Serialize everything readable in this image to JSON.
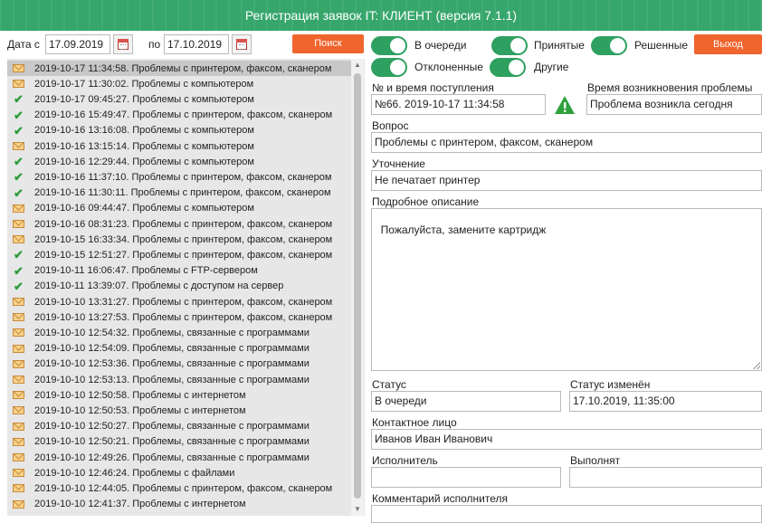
{
  "window": {
    "title": "Регистрация заявок IT: КЛИЕНТ (версия 7.1.1)"
  },
  "filter": {
    "date_from_label": "Дата с",
    "date_from": "17.09.2019",
    "date_to_label": "по",
    "date_to": "17.10.2019",
    "search_label": "Поиск"
  },
  "toggles": {
    "queued": "В очереди",
    "accepted": "Принятые",
    "solved": "Решенные",
    "rejected": "Отклоненные",
    "other": "Другие"
  },
  "exit_label": "Выход",
  "requests": [
    {
      "icon": "envelope-icon",
      "text": "2019-10-17 11:34:58. Проблемы с принтером, факсом, сканером",
      "selected": true
    },
    {
      "icon": "envelope-icon",
      "text": "2019-10-17 11:30:02. Проблемы с компьютером"
    },
    {
      "icon": "check-icon",
      "text": "2019-10-17 09:45:27. Проблемы с компьютером"
    },
    {
      "icon": "check-icon",
      "text": "2019-10-16 15:49:47. Проблемы с принтером, факсом, сканером"
    },
    {
      "icon": "check-icon",
      "text": "2019-10-16 13:16:08. Проблемы с компьютером"
    },
    {
      "icon": "envelope-icon",
      "text": "2019-10-16 13:15:14. Проблемы с компьютером"
    },
    {
      "icon": "check-icon",
      "text": "2019-10-16 12:29:44. Проблемы с компьютером"
    },
    {
      "icon": "check-icon",
      "text": "2019-10-16 11:37:10. Проблемы с принтером, факсом, сканером"
    },
    {
      "icon": "check-icon",
      "text": "2019-10-16 11:30:11. Проблемы с принтером, факсом, сканером"
    },
    {
      "icon": "envelope-icon",
      "text": "2019-10-16 09:44:47. Проблемы с компьютером"
    },
    {
      "icon": "envelope-icon",
      "text": "2019-10-16 08:31:23. Проблемы с принтером, факсом, сканером"
    },
    {
      "icon": "envelope-icon",
      "text": "2019-10-15 16:33:34. Проблемы с принтером, факсом, сканером"
    },
    {
      "icon": "check-icon",
      "text": "2019-10-15 12:51:27. Проблемы с принтером, факсом, сканером"
    },
    {
      "icon": "check-icon",
      "text": "2019-10-11 16:06:47. Проблемы с FTP-сервером"
    },
    {
      "icon": "check-icon",
      "text": "2019-10-11 13:39:07. Проблемы с доступом на сервер"
    },
    {
      "icon": "envelope-icon",
      "text": "2019-10-10 13:31:27. Проблемы с принтером, факсом, сканером"
    },
    {
      "icon": "envelope-icon",
      "text": "2019-10-10 13:27:53. Проблемы с принтером, факсом, сканером"
    },
    {
      "icon": "envelope-icon",
      "text": "2019-10-10 12:54:32. Проблемы, связанные с программами"
    },
    {
      "icon": "envelope-icon",
      "text": "2019-10-10 12:54:09. Проблемы, связанные с программами"
    },
    {
      "icon": "envelope-icon",
      "text": "2019-10-10 12:53:36. Проблемы, связанные с программами"
    },
    {
      "icon": "envelope-icon",
      "text": "2019-10-10 12:53:13. Проблемы, связанные с программами"
    },
    {
      "icon": "envelope-icon",
      "text": "2019-10-10 12:50:58. Проблемы с интернетом"
    },
    {
      "icon": "envelope-icon",
      "text": "2019-10-10 12:50:53. Проблемы с интернетом"
    },
    {
      "icon": "envelope-icon",
      "text": "2019-10-10 12:50:27. Проблемы, связанные с программами"
    },
    {
      "icon": "envelope-icon",
      "text": "2019-10-10 12:50:21. Проблемы, связанные с программами"
    },
    {
      "icon": "envelope-icon",
      "text": "2019-10-10 12:49:26. Проблемы, связанные с программами"
    },
    {
      "icon": "envelope-icon",
      "text": "2019-10-10 12:46:24. Проблемы с файлами"
    },
    {
      "icon": "envelope-icon",
      "text": "2019-10-10 12:44:05. Проблемы с принтером, факсом, сканером"
    },
    {
      "icon": "envelope-icon",
      "text": "2019-10-10 12:41:37. Проблемы с интернетом"
    }
  ],
  "details": {
    "number_label": "№ и время поступления",
    "number_value": "№66. 2019-10-17 11:34:58",
    "occurred_label": "Время возникновения проблемы",
    "occurred_value": "Проблема возникла сегодня",
    "question_label": "Вопрос",
    "question_value": "Проблемы с принтером, факсом, сканером",
    "clarification_label": "Уточнение",
    "clarification_value": "Не печатает принтер",
    "description_label": "Подробное описание",
    "description_value": "Пожалуйста, замените картридж",
    "status_label": "Статус",
    "status_value": "В очереди",
    "status_changed_label": "Статус изменён",
    "status_changed_value": "17.10.2019, 11:35:00",
    "contact_label": "Контактное лицо",
    "contact_value": "Иванов Иван Иванович",
    "executor_label": "Исполнитель",
    "executor_value": "",
    "performing_label": "Выполнят",
    "performing_value": "",
    "comment_label": "Комментарий исполнителя",
    "comment_value": ""
  },
  "colors": {
    "titlebar": "#36a66b",
    "toggle_on": "#2ea060",
    "accent_button": "#f0642d",
    "warning": "#2ea03c"
  }
}
